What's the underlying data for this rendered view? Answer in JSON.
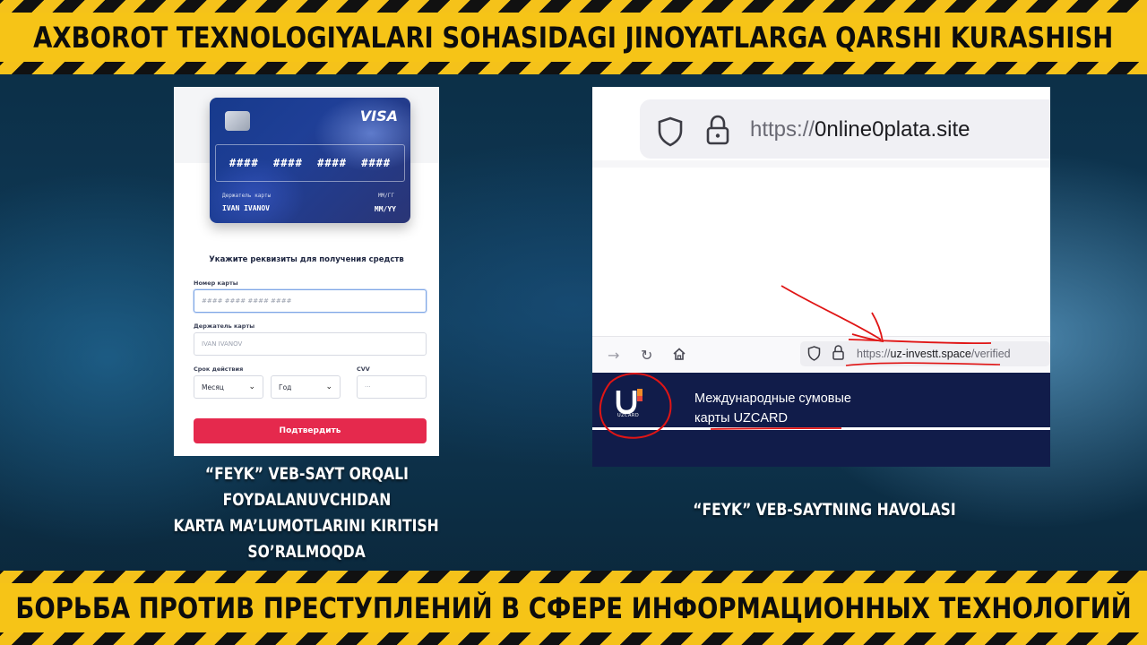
{
  "banners": {
    "top": "AXBOROT TEXNOLOGIYALARI SOHASIDAGI JINOYATLARGA QARSHI KURASHISH",
    "bottom": "БОРЬБА ПРОТИВ ПРЕСТУПЛЕНИЙ В СФЕРЕ ИНФОРМАЦИОННЫХ ТЕХНОЛОГИЙ"
  },
  "card_preview": {
    "brand": "VISA",
    "number": "#### #### #### ####",
    "holder_label": "Держатель карты",
    "holder_name": "IVAN IVANOV",
    "expiry_label": "ММ/ГГ",
    "expiry_value": "MM/YY"
  },
  "form": {
    "title": "Укажите реквизиты для получения средств",
    "card_number_label": "Номер карты",
    "card_number_placeholder": "#### #### #### ####",
    "holder_label": "Держатель карты",
    "holder_placeholder": "IVAN IVANOV",
    "expiry_label": "Срок действия",
    "month_select": "Месяц",
    "year_select": "Год",
    "cvv_label": "CVV",
    "cvv_placeholder": "···",
    "submit_label": "Подтвердить"
  },
  "browser": {
    "url_top_protocol": "https://",
    "url_top_host": "0nline0plata.site",
    "url_small_protocol": "https://",
    "url_small_host": "uz-investt.space",
    "url_small_path": "/verified"
  },
  "uzcard": {
    "logo_text": "UZCARD",
    "line1": "Международные сумовые",
    "line2": "карты UZCARD"
  },
  "captions": {
    "left": [
      "“FEYK” VEB-SAYT ORQALI",
      "FOYDALANUVCHIDAN",
      "KARTA MA’LUMOTLARINI KIRITISH",
      "SO’RALMOQDA"
    ],
    "right": "“FEYK” VEB-SAYTNING HAVOLASI"
  },
  "colors": {
    "hazard_yellow": "#f6c417",
    "submit_red": "#e5294d",
    "uzcard_navy": "#111c4a",
    "annotation_red": "#e01515"
  }
}
